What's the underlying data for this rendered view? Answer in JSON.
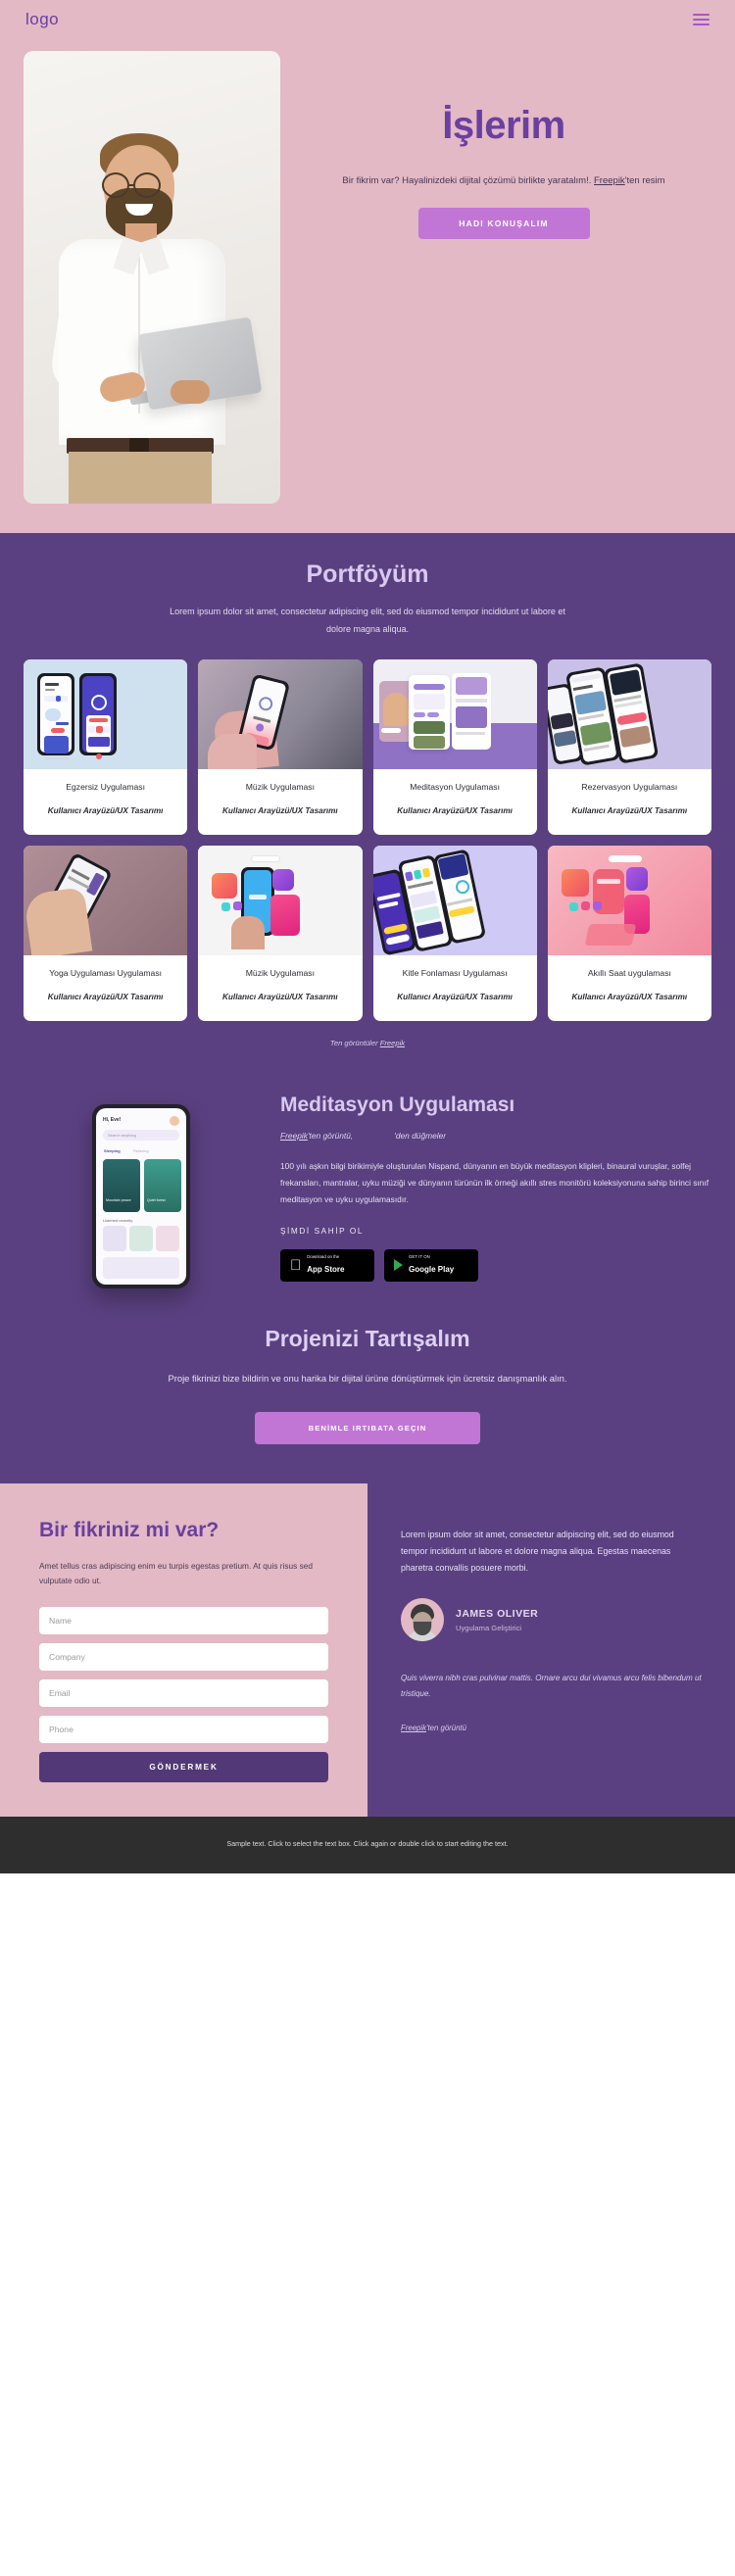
{
  "header": {
    "logo": "logo",
    "menu_icon": "hamburger-icon"
  },
  "hero": {
    "title": "İşlerim",
    "subtitle_part1": "Bir fikrim var? Hayalinizdeki dijital çözümü birlikte yaratalım!.",
    "subtitle_link": "Freepik",
    "subtitle_part2": "'ten resim",
    "cta_label": "HADI KONUŞALIM"
  },
  "portfolio": {
    "title": "Portföyüm",
    "description": "Lorem ipsum dolor sit amet, consectetur adipiscing elit, sed do eiusmod tempor incididunt ut labore et dolore magna aliqua.",
    "cards": [
      {
        "title": "Egzersiz Uygulaması",
        "subtitle": "Kullanıcı Arayüzü/UX Tasarımı",
        "scene": "sc-fit"
      },
      {
        "title": "Müzik Uygulaması",
        "subtitle": "Kullanıcı Arayüzü/UX Tasarımı",
        "scene": "sc-music"
      },
      {
        "title": "Meditasyon Uygulaması",
        "subtitle": "Kullanıcı Arayüzü/UX Tasarımı",
        "scene": "sc-medi"
      },
      {
        "title": "Rezervasyon Uygulaması",
        "subtitle": "Kullanıcı Arayüzü/UX Tasarımı",
        "scene": "sc-rez"
      },
      {
        "title": "Yoga Uygulaması Uygulaması",
        "subtitle": "Kullanıcı Arayüzü/UX Tasarımı",
        "scene": "sc-yoga"
      },
      {
        "title": "Müzik Uygulaması",
        "subtitle": "Kullanıcı Arayüzü/UX Tasarımı",
        "scene": "sc-music2"
      },
      {
        "title": "Kitle Fonlaması Uygulaması",
        "subtitle": "Kullanıcı Arayüzü/UX Tasarımı",
        "scene": "sc-crowd"
      },
      {
        "title": "Akıllı Saat uygulaması",
        "subtitle": "Kullanıcı Arayüzü/UX Tasarımı",
        "scene": "sc-watch"
      }
    ],
    "credit_prefix": "Ten görüntüler ",
    "credit_link": "Freepik"
  },
  "feature": {
    "title": "Meditasyon Uygulaması",
    "credit_link": "Freepik",
    "credit_suffix": "'ten görüntü,",
    "credit_second": "'den düğmeler",
    "body": "100 yılı aşkın bilgi birikimiyle oluşturulan Nispand, dünyanın en büyük meditasyon klipleri, binaural vuruşlar, solfej frekansları, mantralar, uyku müziği ve dünyanın türünün ilk örneği akıllı stres monitörü koleksiyonuna sahip birinci sınıf meditasyon ve uyku uygulamasıdır.",
    "cta": "ŞİMDİ SAHİP OL",
    "stores": [
      {
        "small": "Download on the",
        "name": "App Store",
        "icon": "apple-icon"
      },
      {
        "small": "GET IT ON",
        "name": "Google Play",
        "icon": "google-play-icon"
      }
    ],
    "phone_mock": {
      "greeting": "Hi, Eve!",
      "search_placeholder": "Search anything",
      "tabs": [
        "Sleeping",
        "Relaxing"
      ],
      "tile1": "Mountain peace",
      "tile2": "Quiet forest",
      "section": "Listened recently"
    }
  },
  "discuss": {
    "title": "Projenizi Tartışalım",
    "description": "Proje fikrinizi bize bildirin ve onu harika bir dijital ürüne dönüştürmek için ücretsiz danışmanlık alın.",
    "cta_label": "BENİMLE IRTIBATA GEÇIN"
  },
  "contact": {
    "title": "Bir fikriniz mi var?",
    "description": "Amet tellus cras adipiscing enim eu turpis egestas pretium. At quis risus sed vulputate odio ut.",
    "fields": [
      {
        "name": "name-field",
        "placeholder": "Name"
      },
      {
        "name": "company-field",
        "placeholder": "Company"
      },
      {
        "name": "email-field",
        "placeholder": "Email"
      },
      {
        "name": "phone-field",
        "placeholder": "Phone"
      }
    ],
    "submit_label": "GÖNDERMEK"
  },
  "testimonial": {
    "lead": "Lorem ipsum dolor sit amet, consectetur adipiscing elit, sed do eiusmod tempor incididunt ut labore et dolore magna aliqua. Egestas maecenas pharetra convallis posuere morbi.",
    "name": "JAMES OLIVER",
    "role": "Uygulama Geliştirici",
    "quote": "Quis viverra nibh cras pulvinar mattis. Ornare arcu dui vivamus arcu felis bibendum ut tristique.",
    "credit_link": "Freepik",
    "credit_suffix": "'ten görüntü"
  },
  "footer": {
    "text": "Sample text. Click to select the text box. Click again or double click to start editing the text."
  },
  "colors": {
    "pink": "#e2b9c5",
    "purple": "#5a4080",
    "accent": "#c176d6",
    "heading_purple": "#6b3fa0",
    "footer_dark": "#2e2e2e"
  }
}
